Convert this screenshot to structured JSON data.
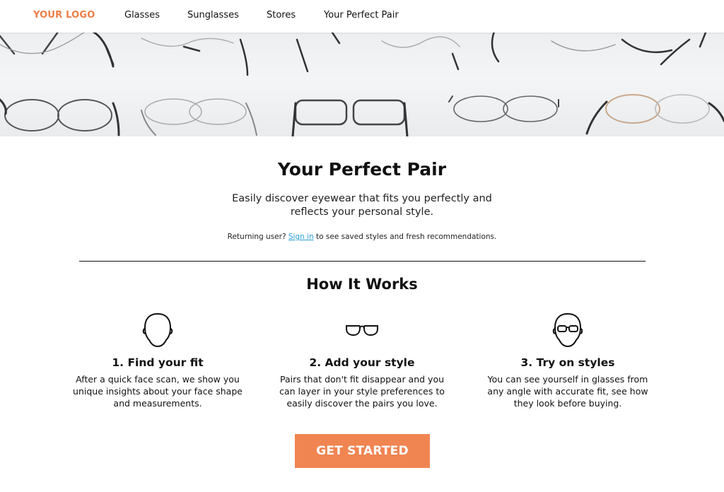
{
  "nav": {
    "logo": "YOUR LOGO",
    "links": [
      "Glasses",
      "Sunglasses",
      "Stores",
      "Your Perfect Pair"
    ]
  },
  "hero": {
    "image": "eyeglasses-display-photo"
  },
  "main": {
    "title": "Your Perfect Pair",
    "subtitle": "Easily discover eyewear that fits you perfectly and reflects your personal style.",
    "returning_prefix": "Returning user?",
    "sign_in": "Sign in",
    "returning_suffix": "to see saved styles and fresh recommendations."
  },
  "how": {
    "title": "How It Works",
    "steps": [
      {
        "icon": "face-outline-icon",
        "title": "1. Find your fit",
        "text": "After a quick face scan, we show you unique insights about your face shape and measurements."
      },
      {
        "icon": "glasses-icon",
        "title": "2. Add your style",
        "text": "Pairs that don't fit disappear and you can layer in your style preferences to easily discover the pairs you love."
      },
      {
        "icon": "face-with-glasses-icon",
        "title": "3. Try on styles",
        "text": "You can see yourself in glasses from any angle with accurate fit, see how they look before buying."
      }
    ]
  },
  "cta": {
    "label": "GET STARTED"
  },
  "colors": {
    "accent": "#ee7d45",
    "button": "#f08552",
    "link": "#2a9fd8"
  }
}
